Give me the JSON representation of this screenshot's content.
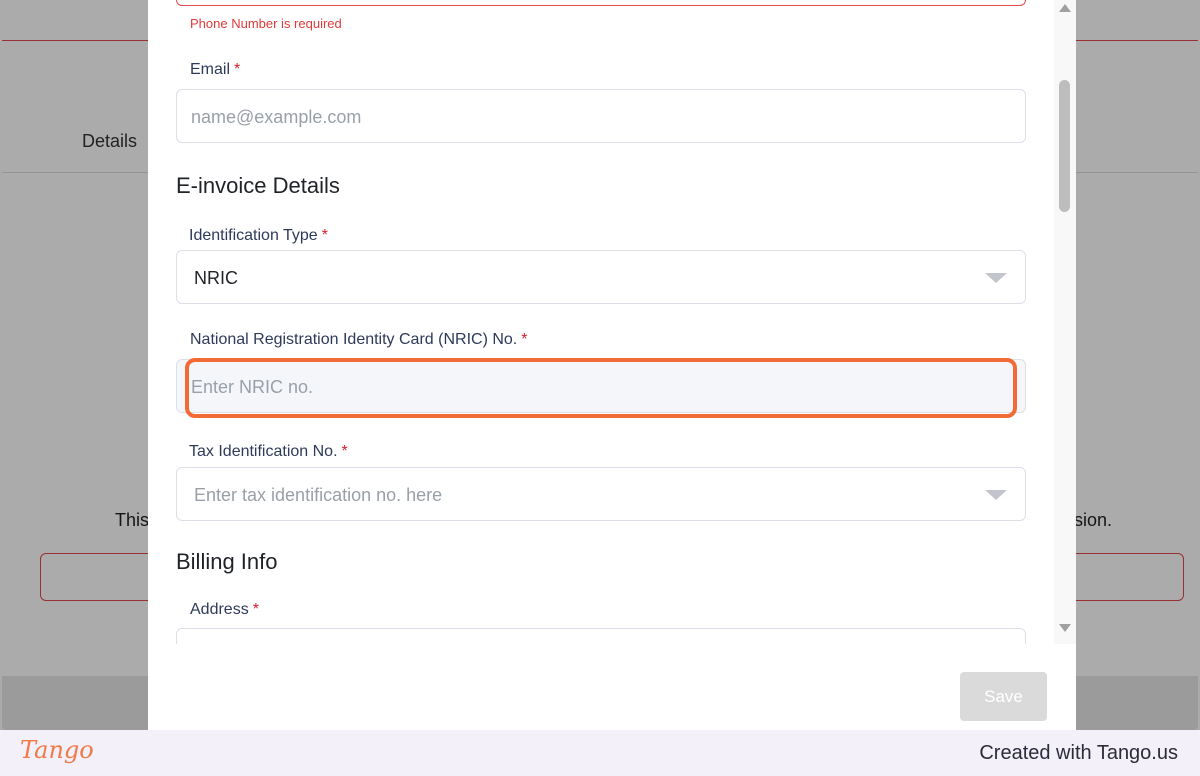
{
  "background": {
    "tab_label": "Details",
    "notice_left": "This",
    "notice_right": "sion."
  },
  "form": {
    "phone_error": "Phone Number is required",
    "email": {
      "label": "Email",
      "required_mark": "*",
      "placeholder": "name@example.com"
    },
    "einvoice_section_title": "E-invoice Details",
    "identification_type": {
      "label": "Identification Type",
      "required_mark": "*",
      "selected_value": "NRIC"
    },
    "nric": {
      "label": "National Registration Identity Card (NRIC) No.",
      "required_mark": "*",
      "placeholder": "Enter NRIC no."
    },
    "tax_id": {
      "label": "Tax Identification No.",
      "required_mark": "*",
      "placeholder": "Enter tax identification no. here"
    },
    "billing_section_title": "Billing Info",
    "address": {
      "label": "Address",
      "required_mark": "*"
    }
  },
  "actions": {
    "save_label": "Save"
  },
  "footer": {
    "logo": "Tango",
    "credit": "Created with Tango.us"
  },
  "colors": {
    "highlight": "#f26b37",
    "required": "#d21f2b",
    "error": "#e03a3a",
    "save_disabled": "#dadada"
  }
}
